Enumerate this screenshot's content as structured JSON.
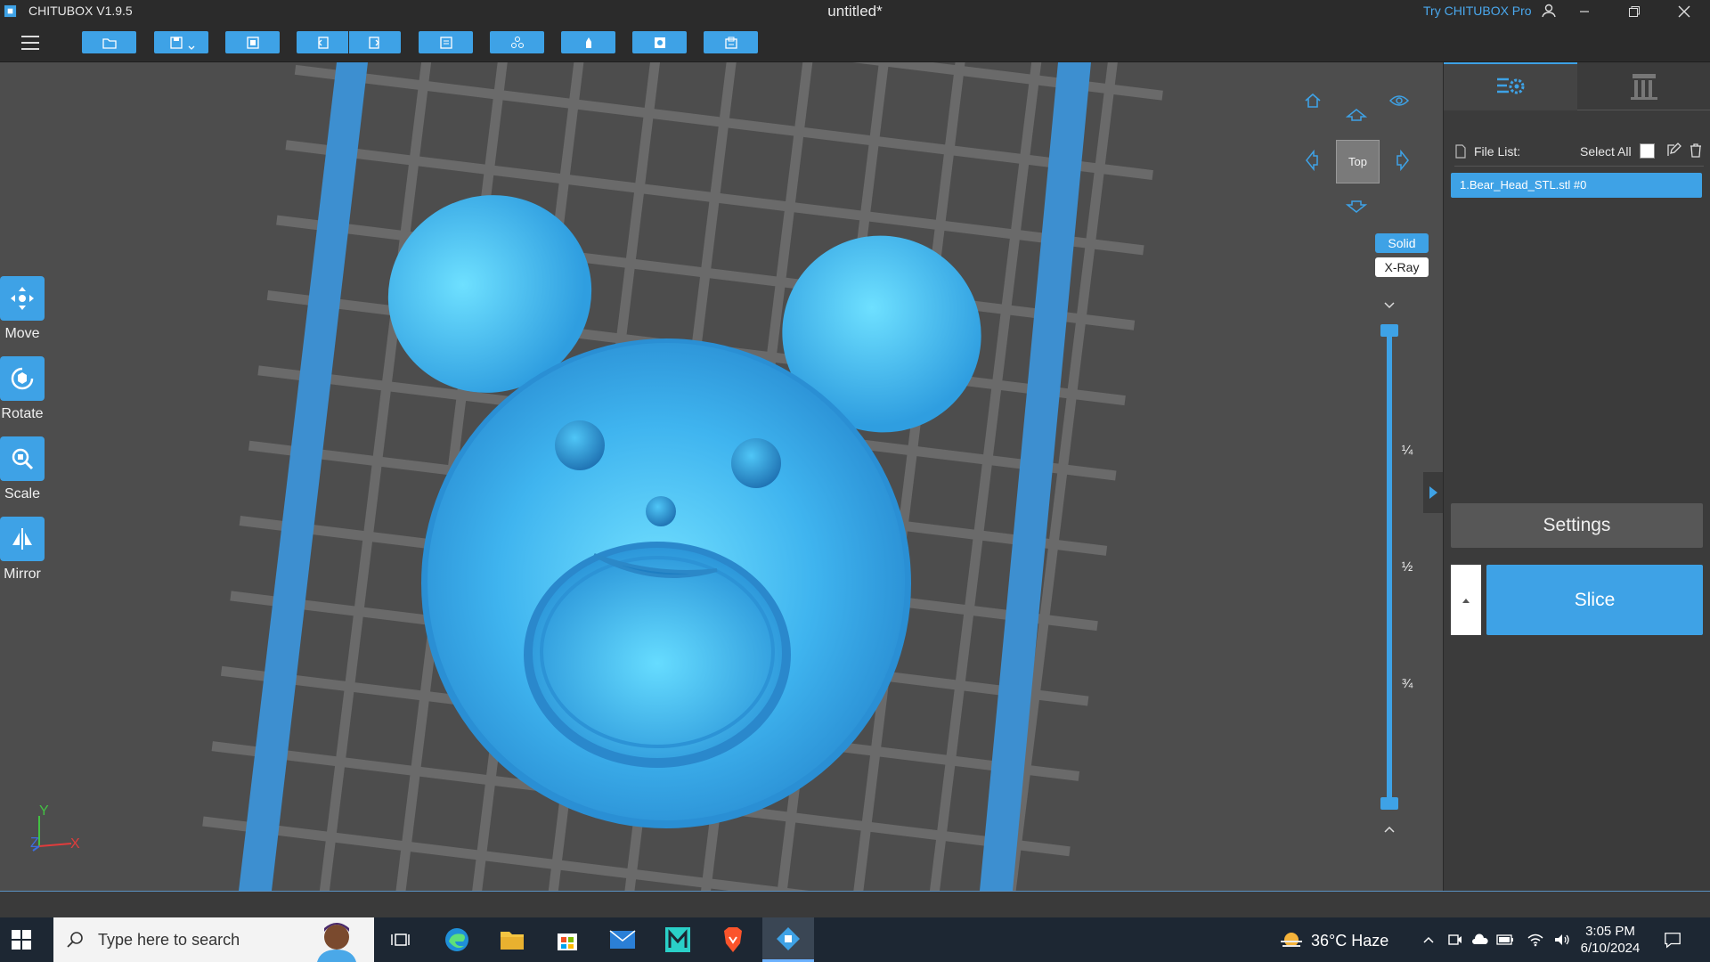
{
  "app": {
    "name": "CHITUBOX V1.9.5",
    "document_title": "untitled*",
    "try_pro": "Try CHITUBOX Pro",
    "accent": "#3ea2e6"
  },
  "toolbar": {
    "icons": [
      "open-folder-icon",
      "save-icon",
      "import-icon",
      "undo-icon",
      "redo-icon",
      "layout-icon",
      "arrange-icon",
      "support-icon",
      "hollow-icon",
      "print-icon"
    ]
  },
  "tools": [
    {
      "label": "Move",
      "icon": "move-icon"
    },
    {
      "label": "Rotate",
      "icon": "rotate-icon"
    },
    {
      "label": "Scale",
      "icon": "scale-icon"
    },
    {
      "label": "Mirror",
      "icon": "mirror-icon"
    }
  ],
  "view": {
    "cube_label": "Top",
    "solid_label": "Solid",
    "xray_label": "X-Ray",
    "active_mode": "Solid"
  },
  "slider": {
    "fractions": [
      "¼",
      "½",
      "¾"
    ]
  },
  "axes": {
    "y": "Y",
    "z": "Z",
    "x": "X"
  },
  "panel": {
    "file_list_label": "File List:",
    "select_all_label": "Select All",
    "files": [
      "1.Bear_Head_STL.stl #0"
    ],
    "settings_label": "Settings",
    "slice_label": "Slice"
  },
  "taskbar": {
    "search_placeholder": "Type here to search",
    "weather": "36°C  Haze",
    "time": "3:05 PM",
    "date": "6/10/2024"
  }
}
